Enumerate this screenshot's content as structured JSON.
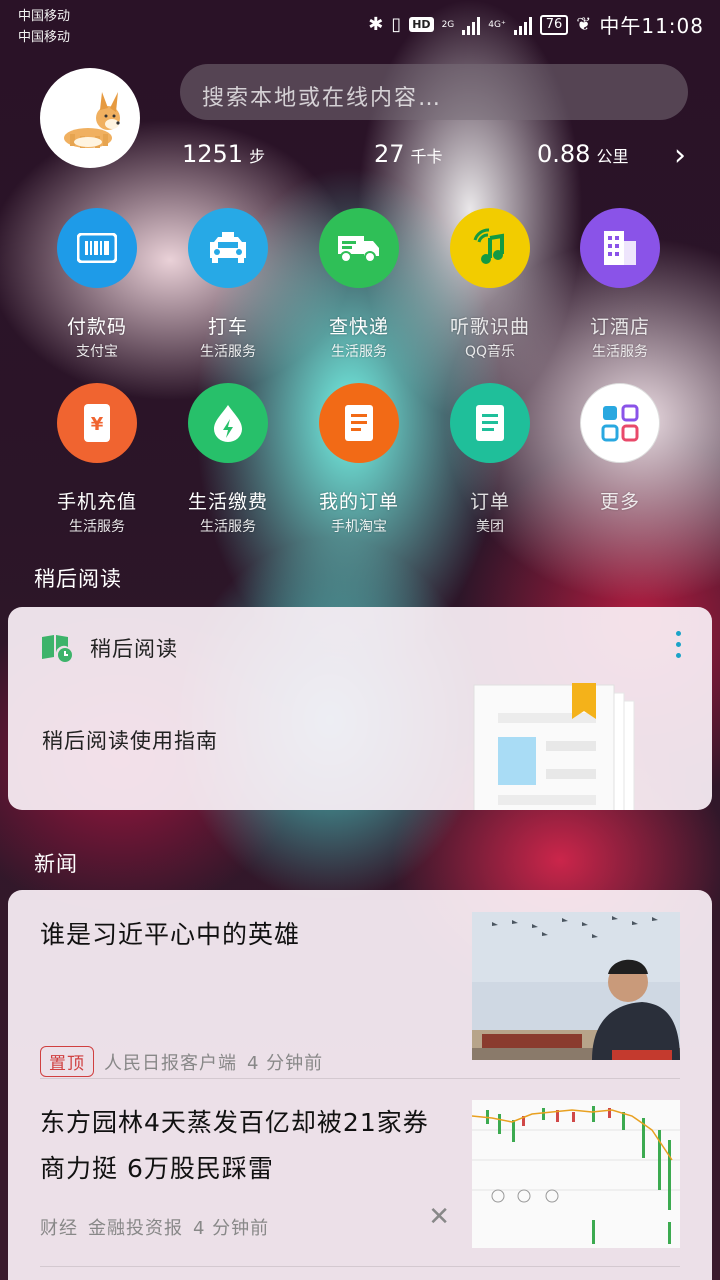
{
  "status_bar": {
    "carrier_1": "中国移动",
    "carrier_2": "中国移动",
    "hd_badge": "HD",
    "net_1": "2G",
    "net_2": "4G⁺",
    "battery": "76",
    "time": "中午11:08"
  },
  "header": {
    "search_placeholder": "搜索本地或在线内容…",
    "steps_value": "1251",
    "steps_unit": "步",
    "calories_value": "27",
    "calories_unit": "千卡",
    "distance_value": "0.88",
    "distance_unit": "公里"
  },
  "apps": [
    {
      "name": "付款码",
      "sub": "支付宝",
      "icon": "barcode-icon",
      "color": "#1e9be8"
    },
    {
      "name": "打车",
      "sub": "生活服务",
      "icon": "taxi-icon",
      "color": "#27a9e6"
    },
    {
      "name": "查快递",
      "sub": "生活服务",
      "icon": "delivery-truck-icon",
      "color": "#2fbf57"
    },
    {
      "name": "听歌识曲",
      "sub": "QQ音乐",
      "icon": "music-note-icon",
      "color": "#f2cc00"
    },
    {
      "name": "订酒店",
      "sub": "生活服务",
      "icon": "hotel-icon",
      "color": "#8a53e8"
    },
    {
      "name": "手机充值",
      "sub": "生活服务",
      "icon": "phone-recharge-icon",
      "color": "#f06430"
    },
    {
      "name": "生活缴费",
      "sub": "生活服务",
      "icon": "utility-bill-icon",
      "color": "#27c06a"
    },
    {
      "name": "我的订单",
      "sub": "手机淘宝",
      "icon": "order-icon",
      "color": "#f26a16"
    },
    {
      "name": "订单",
      "sub": "美团",
      "icon": "document-icon",
      "color": "#1fbf9a"
    },
    {
      "name": "更多",
      "sub": "",
      "icon": "more-apps-icon",
      "color": "#ffffff"
    }
  ],
  "read_later": {
    "section_label": "稍后阅读",
    "card_title": "稍后阅读",
    "guide_text": "稍后阅读使用指南"
  },
  "news": {
    "section_label": "新闻",
    "items": [
      {
        "title": "谁是习近平心中的英雄",
        "pin_label": "置顶",
        "source": "人民日报客户端",
        "time": "4 分钟前"
      },
      {
        "title": "东方园林4天蒸发百亿却被21家券商力挺 6万股民踩雷",
        "category": "财经",
        "source": "金融投资报",
        "time": "4 分钟前"
      }
    ]
  }
}
